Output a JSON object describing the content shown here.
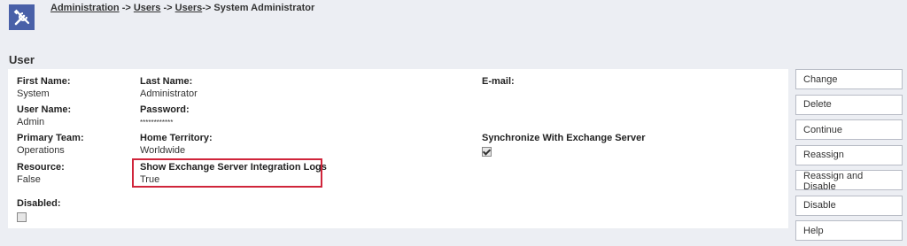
{
  "header": {
    "icon": "tools-icon",
    "breadcrumb": {
      "items": [
        "Administration",
        "Users",
        "Users"
      ],
      "separator": "->",
      "current": "System Administrator"
    }
  },
  "section_title": "User",
  "fields": {
    "first_name": {
      "label": "First Name:",
      "value": "System"
    },
    "last_name": {
      "label": "Last Name:",
      "value": "Administrator"
    },
    "email": {
      "label": "E-mail:",
      "value": ""
    },
    "user_name": {
      "label": "User Name:",
      "value": "Admin"
    },
    "password": {
      "label": "Password:",
      "value": "************"
    },
    "primary_team": {
      "label": "Primary Team:",
      "value": "Operations"
    },
    "home_territory": {
      "label": "Home Territory:",
      "value": "Worldwide"
    },
    "sync_exchange": {
      "label": "Synchronize With Exchange Server",
      "checked": true
    },
    "resource": {
      "label": "Resource:",
      "value": "False"
    },
    "show_exchange_logs": {
      "label": "Show Exchange Server Integration Logs",
      "value": "True"
    },
    "disabled": {
      "label": "Disabled:",
      "checked": false
    }
  },
  "actions": [
    "Change",
    "Delete",
    "Continue",
    "Reassign",
    "Reassign and Disable",
    "Disable",
    "Help"
  ],
  "colors": {
    "icon_bg": "#4960a8",
    "highlight": "#d0253b",
    "page_bg": "#eceef3"
  }
}
